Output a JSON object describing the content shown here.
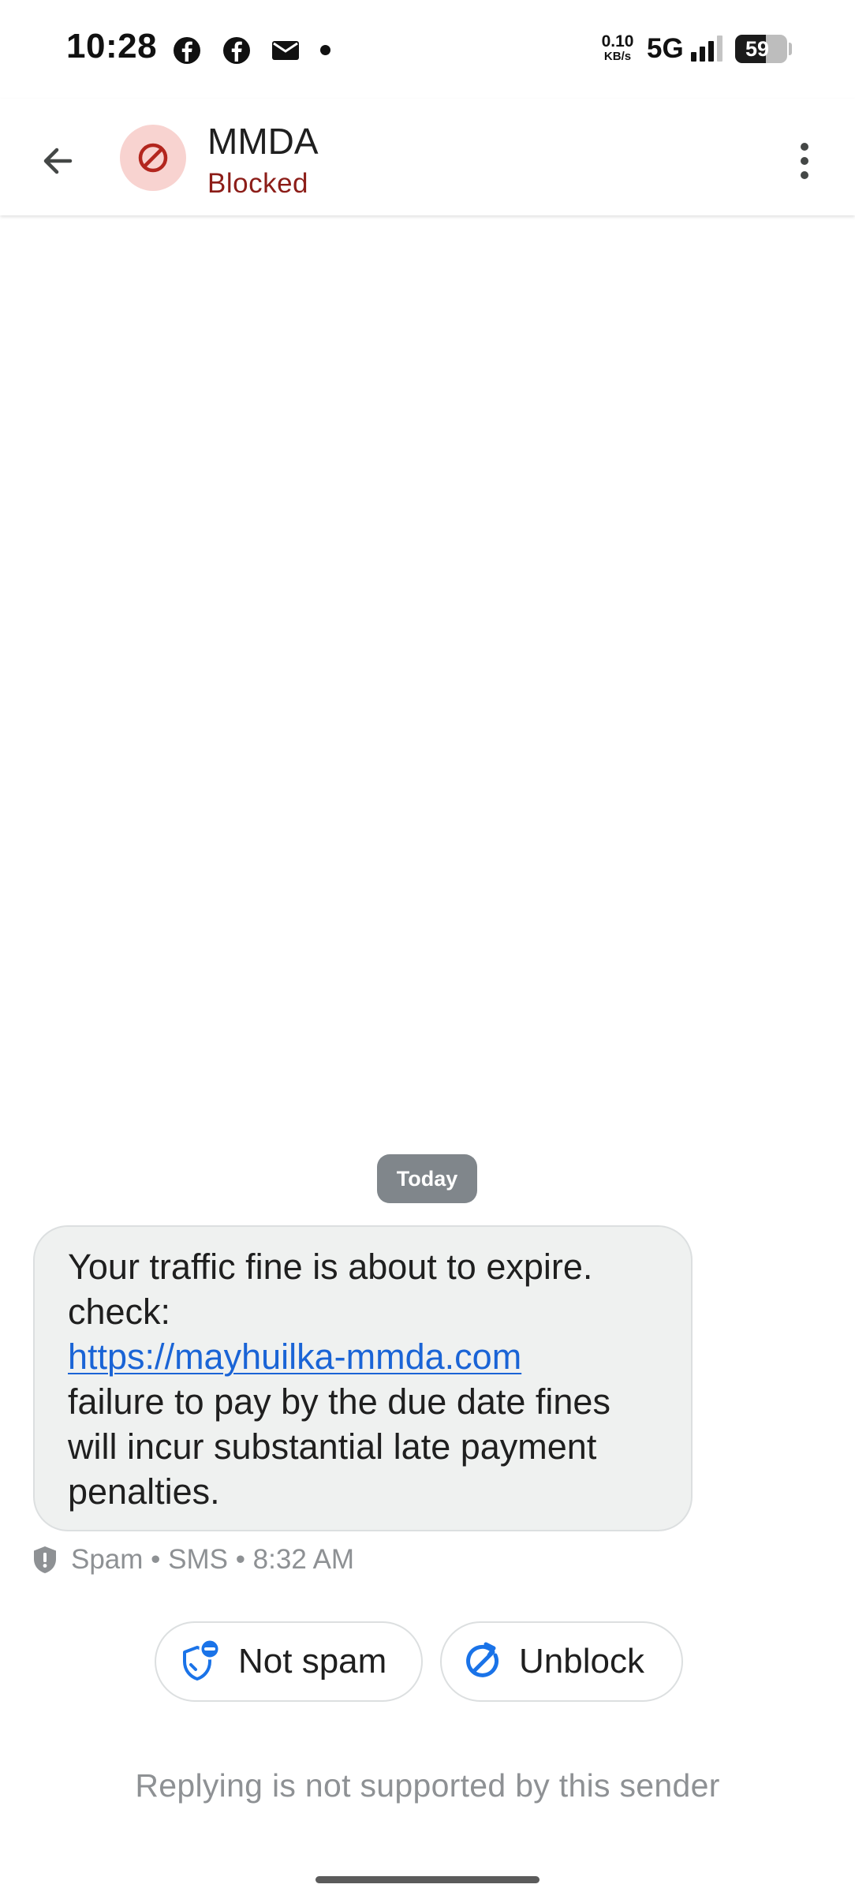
{
  "status_bar": {
    "time": "10:28",
    "notification_icons": [
      "facebook-icon",
      "facebook-icon",
      "mail-icon",
      "dot-icon"
    ],
    "net_speed_value": "0.10",
    "net_speed_unit": "KB/s",
    "network_type": "5G",
    "signal_icon": "signal-icon",
    "battery_level": "59"
  },
  "app_bar": {
    "back_icon": "arrow-back-icon",
    "avatar_icon": "blocked-icon",
    "contact_name": "MMDA",
    "contact_status": "Blocked",
    "menu_icon": "more-vert-icon"
  },
  "conversation": {
    "date_divider": "Today",
    "message": {
      "text_before_link": "Your traffic fine is about to expire. check:",
      "link": "https://mayhuilka-mmda.com",
      "text_after_link": "failure to pay by the due date fines will incur substantial late payment penalties.",
      "meta": "Spam • SMS • 8:32 AM",
      "meta_icon": "spam-shield-icon"
    }
  },
  "actions": {
    "not_spam_label": "Not spam",
    "not_spam_icon": "shield-minus-icon",
    "unblock_label": "Unblock",
    "unblock_icon": "unblock-icon"
  },
  "footer": {
    "reply_note": "Replying is not supported by this sender"
  },
  "colors": {
    "blocked_red": "#8c1d18",
    "avatar_bg": "#f8d3d0",
    "link_blue": "#1a64d6",
    "bubble_bg": "#eff1f0",
    "chip_grey": "#80868b",
    "accent_blue": "#1a73e8"
  }
}
